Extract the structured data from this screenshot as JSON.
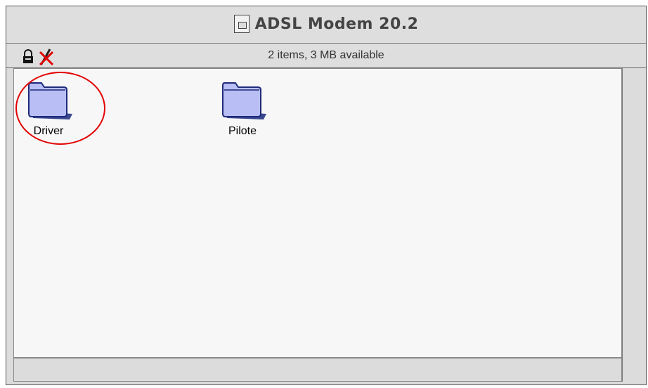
{
  "window": {
    "title": "ADSL Modem 20.2",
    "title_icon": "document-icon"
  },
  "header": {
    "status": "2 items, 3 MB available",
    "icons": [
      "lock-icon",
      "no-write-icon"
    ]
  },
  "items": [
    {
      "label": "Driver",
      "icon": "folder-icon",
      "highlighted": true
    },
    {
      "label": "Pilote",
      "icon": "folder-icon",
      "highlighted": false
    }
  ],
  "colors": {
    "folder_fill": "#b9bff5",
    "folder_stroke": "#1f2a7a",
    "highlight": "#e20000"
  }
}
